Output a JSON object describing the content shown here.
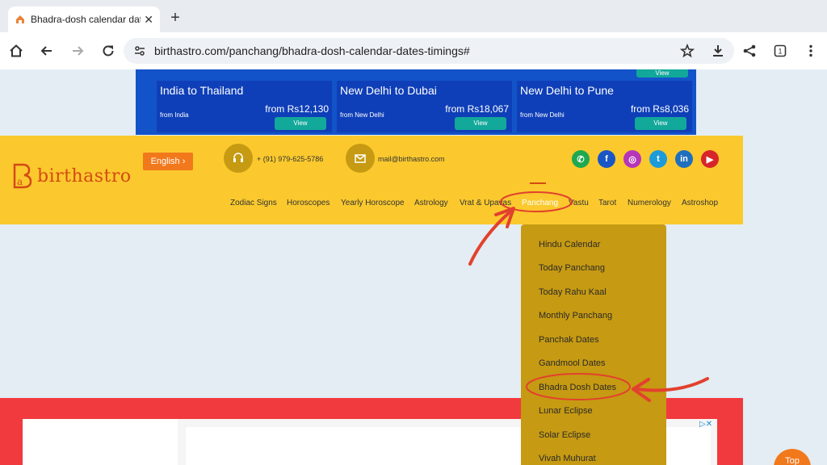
{
  "browser": {
    "tab_title": "Bhadra-dosh calendar date",
    "url": "birthastro.com/panchang/bhadra-dosh-calendar-dates-timings#"
  },
  "ads": {
    "cards": [
      {
        "dest": "India to Thailand",
        "price": "from Rs12,130",
        "from": "from India",
        "view": "View"
      },
      {
        "dest": "New Delhi to Dubai",
        "price": "from Rs18,067",
        "from": "from New Delhi",
        "view": "View"
      },
      {
        "dest": "New Delhi to Pune",
        "price": "from Rs8,036",
        "from": "from New Delhi",
        "view": "View"
      }
    ],
    "top_view": "View",
    "adchoice": "▷✕"
  },
  "header": {
    "logo_text": "birthastro",
    "language": "English",
    "phone": "+ (91) 979-625-5786",
    "email": "mail@birthastro.com",
    "social": [
      "whatsapp",
      "facebook",
      "instagram",
      "twitter",
      "linkedin",
      "youtube"
    ],
    "nav": [
      "Zodiac Signs",
      "Horoscopes",
      "Yearly Horoscope",
      "Astrology",
      "Vrat & Upavas",
      "Panchang",
      "Vastu",
      "Tarot",
      "Numerology",
      "Astroshop"
    ]
  },
  "dropdown": {
    "items": [
      "Hindu Calendar",
      "Today Panchang",
      "Today Rahu Kaal",
      "Monthly Panchang",
      "Panchak Dates",
      "Gandmool Dates",
      "Bhadra Dosh Dates",
      "Lunar Eclipse",
      "Solar Eclipse",
      "Vivah Muhurat"
    ]
  },
  "top_button": "Top",
  "colors": {
    "header": "#fbc92d",
    "dropdown": "#c69a12",
    "annotation": "#e2412e",
    "ad_strip": "#1353c9"
  }
}
